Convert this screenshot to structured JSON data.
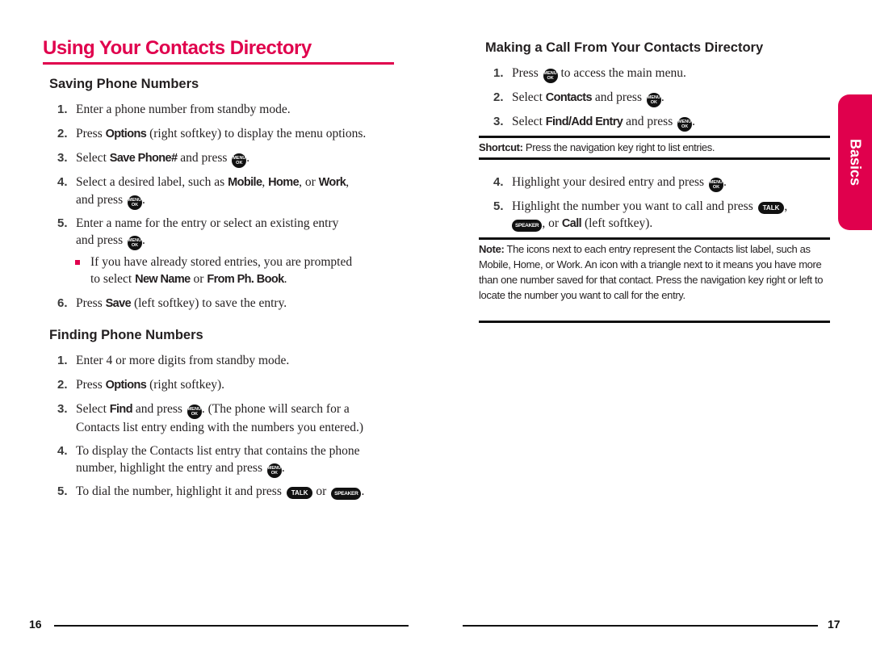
{
  "left_page": {
    "title": "Using Your Contacts Directory",
    "saving": {
      "heading": "Saving Phone Numbers",
      "steps": [
        {
          "num": "1.",
          "text": "Enter a phone number from standby mode."
        },
        {
          "num": "2.",
          "pre": "Press ",
          "kw": "Options",
          "post": " (right softkey) to display the menu options."
        },
        {
          "num": "3.",
          "pre": "Select ",
          "kw": "Save Phone#",
          "post": " and press"
        },
        {
          "num": "4.",
          "pre": "Select a desired label, such as ",
          "kw1": "Mobile",
          "sep1": ", ",
          "kw2": "Home",
          "sep2": ", or ",
          "kw3": "Work",
          "post": ",",
          "line2": "and press"
        },
        {
          "num": "5.",
          "line1": "Enter a name for the entry or select an existing entry",
          "line2": "and press"
        },
        {
          "num": "6.",
          "pre": "Press ",
          "kw": "Save",
          "post": " (left softkey) to save the entry."
        }
      ],
      "bullet": {
        "line1": "If you have already stored entries, you are prompted",
        "pre": "to select ",
        "kw1": "New Name",
        "sep": " or ",
        "kw2": "From Ph. Book",
        "post": "."
      }
    },
    "finding": {
      "heading": "Finding Phone Numbers",
      "steps": [
        {
          "num": "1.",
          "text": "Enter 4 or more digits from standby mode."
        },
        {
          "num": "2.",
          "pre": "Press ",
          "kw": "Options",
          "post": " (right softkey)."
        },
        {
          "num": "3.",
          "pre": "Select ",
          "kw": "Find",
          "mid": " and press",
          "post": ". (The phone will search for a",
          "line2": "Contacts list entry ending with the numbers you entered.)"
        },
        {
          "num": "4.",
          "line1": "To display the Contacts list entry that contains the phone",
          "line2": "number, highlight the entry and press"
        },
        {
          "num": "5.",
          "pre": "To dial the number, highlight it and press",
          "sep": " or "
        }
      ]
    },
    "page_number": "16"
  },
  "right_page": {
    "heading": "Making a Call From Your Contacts Directory",
    "steps": [
      {
        "num": "1.",
        "pre": "Press",
        "post": " to access the main menu."
      },
      {
        "num": "2.",
        "pre": "Select ",
        "kw": "Contacts",
        "post": " and press"
      },
      {
        "num": "3.",
        "pre": "Select ",
        "kw": "Find/Add Entry",
        "post": " and press"
      },
      {
        "num": "4.",
        "pre": "Highlight your desired entry and press"
      },
      {
        "num": "5.",
        "pre": "Highlight the number you want to call and press",
        "sep": ", or ",
        "kw": "Call",
        "post": " (left softkey)."
      }
    ],
    "shortcut": {
      "label": "Shortcut:",
      "text": " Press the navigation key right to list entries."
    },
    "note": {
      "label": "Note:",
      "text": " The icons next to each entry represent the Contacts list label, such as Mobile, Home, or Work. An icon with a triangle next to it means you have more than one number saved for that contact. Press the navigation key right or left to locate the number you want to call for the entry."
    },
    "page_number": "17"
  },
  "side_tab": {
    "label": "Basics"
  },
  "keys": {
    "menu_top": "MENU",
    "menu_bottom": "OK",
    "talk": "TALK",
    "speaker": "SPEAKER"
  },
  "colors": {
    "accent": "#e0004d",
    "text": "#231f20"
  }
}
